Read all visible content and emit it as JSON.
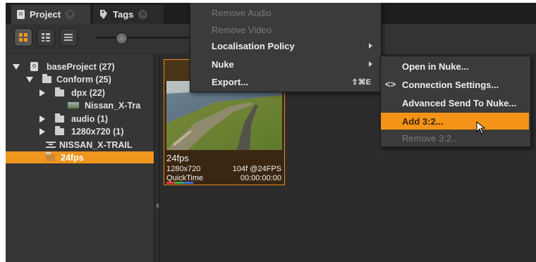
{
  "tabs": [
    {
      "label": "Project",
      "active": true
    },
    {
      "label": "Tags",
      "active": false
    }
  ],
  "view_buttons": [
    "grid-view",
    "detail-view",
    "list-view"
  ],
  "tree": {
    "items": [
      {
        "label": "baseProject (27)",
        "icon": "project-icon",
        "expander": "expanded"
      },
      {
        "label": "Conform (25)",
        "icon": "bin-icon",
        "expander": "expanded"
      },
      {
        "label": "dpx (22)",
        "icon": "bin-icon",
        "expander": "collapsed"
      },
      {
        "label": "Nissan_X-Tra",
        "icon": "clip-icon",
        "expander": "none"
      },
      {
        "label": "audio (1)",
        "icon": "bin-icon",
        "expander": "collapsed"
      },
      {
        "label": "1280x720 (1)",
        "icon": "bin-icon",
        "expander": "collapsed"
      },
      {
        "label": "NISSAN_X-TRAIL",
        "icon": "sequence-icon",
        "expander": "none"
      },
      {
        "label": "24fps",
        "icon": "bin-icon",
        "expander": "none",
        "selected": true
      }
    ]
  },
  "clip": {
    "name": "24fps",
    "resolution": "1280x720",
    "frames": "104f @24FPS",
    "format": "QuickTime",
    "timecode": "00:00:00:00"
  },
  "context_menu": {
    "items": [
      {
        "label": "Remove Audio",
        "enabled": false
      },
      {
        "label": "Remove Video",
        "enabled": false
      },
      {
        "label": "Localisation Policy",
        "enabled": true,
        "submenu": true
      },
      {
        "label": "Nuke",
        "enabled": true,
        "submenu": true
      },
      {
        "label": "Export...",
        "enabled": true,
        "shortcut": "⇧⌘E"
      }
    ]
  },
  "nuke_submenu": {
    "items": [
      {
        "label": "Open in Nuke...",
        "enabled": true
      },
      {
        "label": "Connection Settings...",
        "enabled": true,
        "icon": "code-brackets-icon"
      },
      {
        "label": "Advanced Send To Nuke...",
        "enabled": true
      },
      {
        "label": "Add 3:2...",
        "enabled": true,
        "highlighted": true
      },
      {
        "label": "Remove 3:2...",
        "enabled": false
      }
    ]
  },
  "colors": {
    "accent": "#f39418",
    "selection": "#f0961e",
    "panel": "#363636",
    "menu": "#3b3b3b"
  }
}
